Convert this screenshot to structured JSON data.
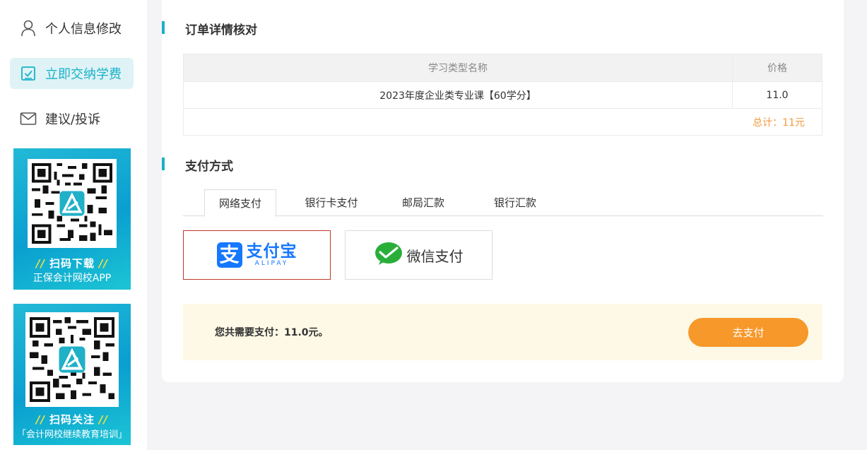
{
  "sidebar": {
    "items": [
      {
        "label": "个人信息修改",
        "icon": "user-icon",
        "active": false
      },
      {
        "label": "立即交纳学费",
        "icon": "checkbox-icon",
        "active": true
      },
      {
        "label": "建议/投诉",
        "icon": "mail-icon",
        "active": false
      }
    ],
    "promos": [
      {
        "scan_text": "扫码下载",
        "subtitle": "正保会计网校APP"
      },
      {
        "scan_text": "扫码关注",
        "subtitle": "「会计网校继续教育培训」"
      }
    ]
  },
  "order": {
    "title": "订单详情核对",
    "columns": [
      "学习类型名称",
      "价格"
    ],
    "rows": [
      {
        "name": "2023年度企业类专业课【60学分】",
        "price": "11.0"
      }
    ],
    "total_label": "总计：11元"
  },
  "payment": {
    "title": "支付方式",
    "tabs": [
      "网络支付",
      "银行卡支付",
      "邮局汇款",
      "银行汇款"
    ],
    "active_tab": 0,
    "options": [
      {
        "name": "支付宝",
        "sub": "ALIPAY",
        "selected": true
      },
      {
        "name": "微信支付",
        "selected": false
      }
    ]
  },
  "summary": {
    "text": "您共需要支付：11.0元。",
    "button": "去支付"
  },
  "colors": {
    "accent": "#19b1c7",
    "pay_button": "#f7982a",
    "total_text": "#f39a3e",
    "alipay_blue": "#1677ff",
    "wechat_green": "#2aae3a",
    "selected_border": "#c0392b"
  }
}
